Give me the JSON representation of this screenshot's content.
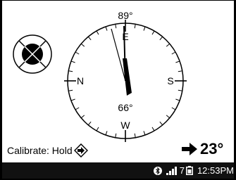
{
  "compass": {
    "top_reading": "89°",
    "center_reading": "66°",
    "cardinals": {
      "north": "N",
      "east": "E",
      "south": "S",
      "west": "W"
    }
  },
  "calibrate": {
    "label": "Calibrate: Hold",
    "icon": "diamond-right-arrow-icon"
  },
  "heading": {
    "arrow_icon": "right-arrow-icon",
    "value": "23°"
  },
  "status_bar": {
    "bluetooth_icon": "bluetooth-icon",
    "signal_icon": "signal-icon",
    "signal_count": "7",
    "battery_icon": "battery-icon",
    "time": "12:53PM"
  }
}
